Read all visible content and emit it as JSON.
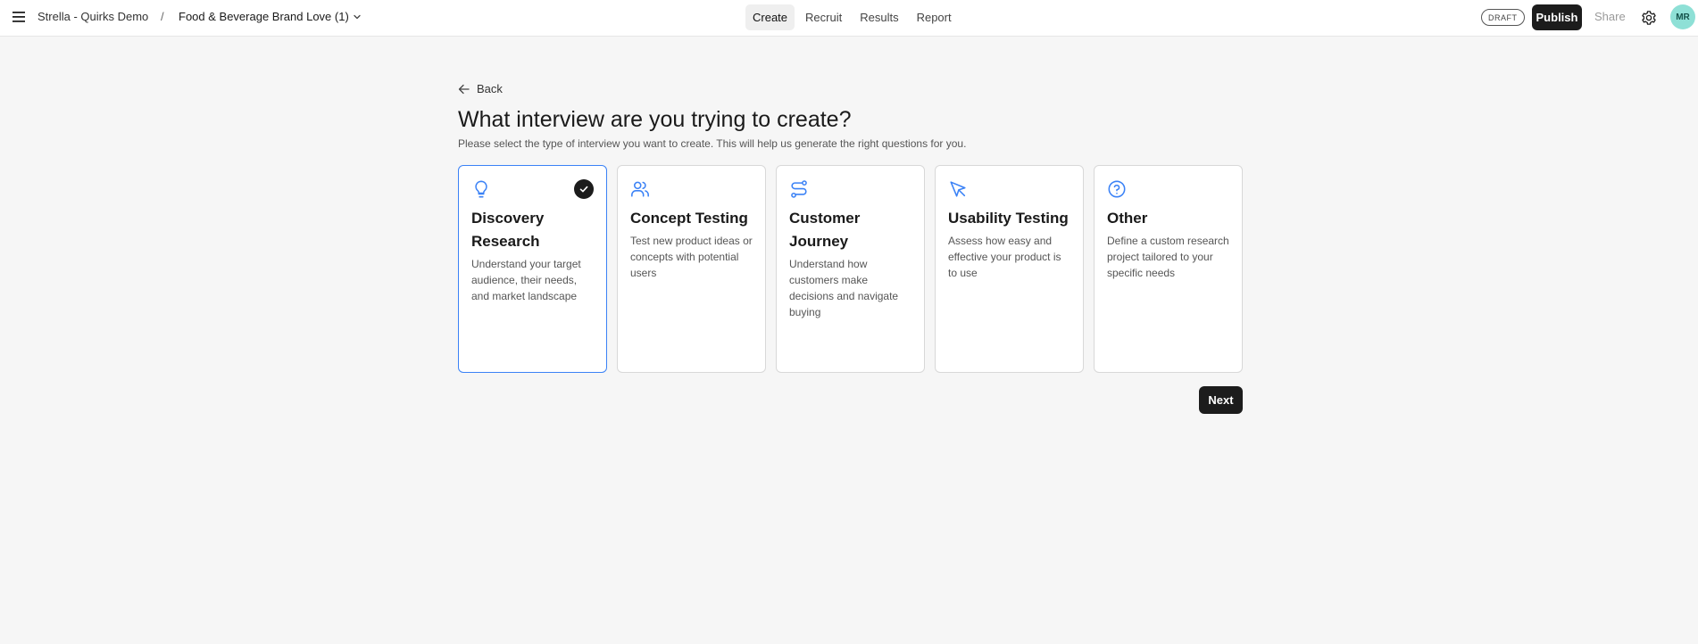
{
  "header": {
    "project_name": "Strella - Quirks Demo",
    "separator": "/",
    "study_name": "Food & Beverage Brand Love (1)",
    "tabs": [
      {
        "label": "Create",
        "active": true
      },
      {
        "label": "Recruit",
        "active": false
      },
      {
        "label": "Results",
        "active": false
      },
      {
        "label": "Report",
        "active": false
      }
    ],
    "status_badge": "DRAFT",
    "publish_label": "Publish",
    "share_label": "Share",
    "avatar_initials": "MR"
  },
  "main": {
    "back_label": "Back",
    "title": "What interview are you trying to create?",
    "subtitle": "Please select the type of interview you want to create. This will help us generate the right questions for you.",
    "cards": [
      {
        "icon": "lightbulb-icon",
        "title": "Discovery Research",
        "description": "Understand your target audience, their needs, and market landscape",
        "selected": true
      },
      {
        "icon": "users-icon",
        "title": "Concept Testing",
        "description": "Test new product ideas or concepts with potential users",
        "selected": false
      },
      {
        "icon": "route-icon",
        "title": "Customer Journey",
        "description": "Understand how customers make decisions and navigate buying",
        "selected": false
      },
      {
        "icon": "cursor-icon",
        "title": "Usability Testing",
        "description": "Assess how easy and effective your product is to use",
        "selected": false
      },
      {
        "icon": "help-circle-icon",
        "title": "Other",
        "description": "Define a custom research project tailored to your specific needs",
        "selected": false
      }
    ],
    "next_label": "Next"
  },
  "colors": {
    "accent": "#3b82f6",
    "primary_button": "#1c1c1c",
    "avatar_bg": "#8ee0d6",
    "background": "#f6f6f6"
  }
}
